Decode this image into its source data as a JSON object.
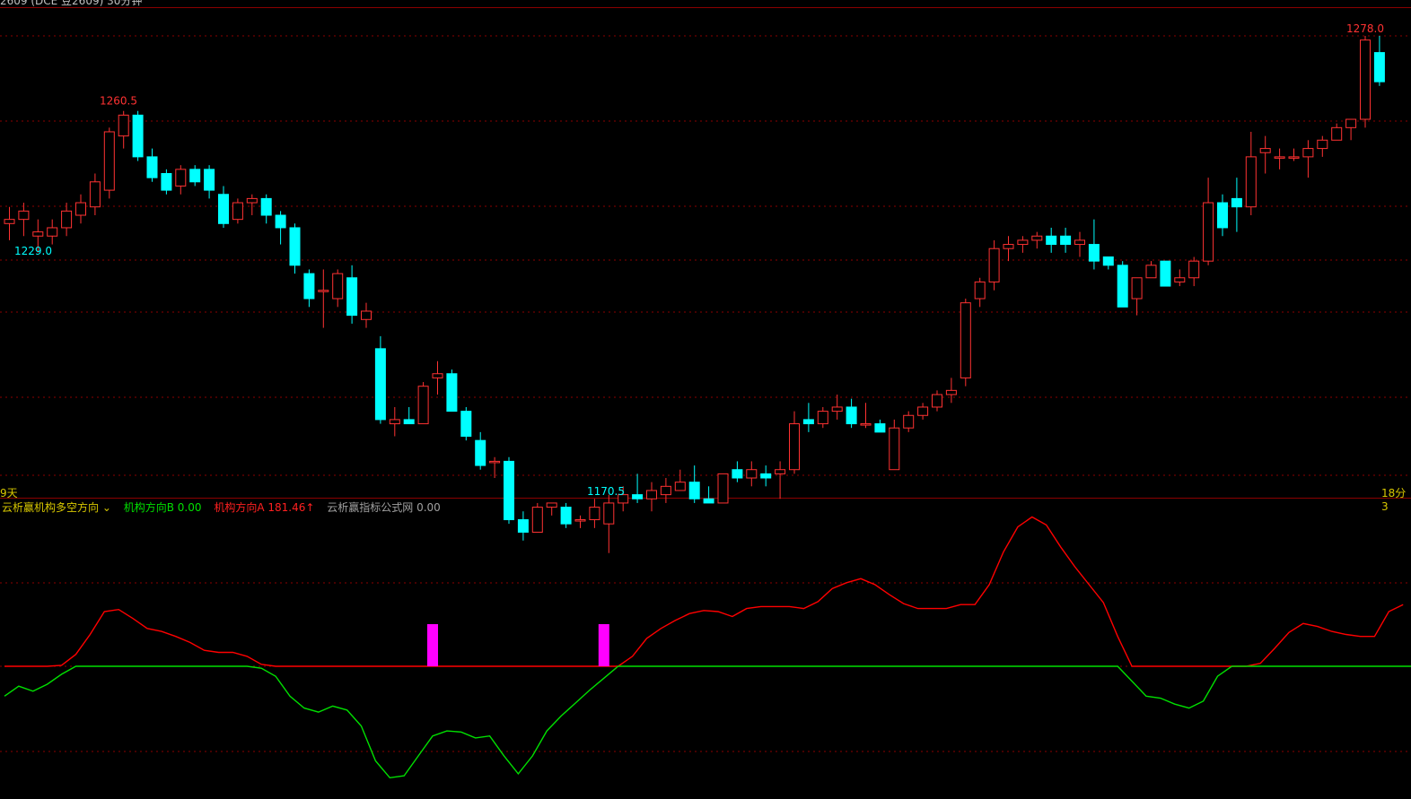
{
  "header": {
    "title_fragment": "2609 (DCE 豆2609) 30分钟"
  },
  "footer": {
    "left_text": "9天",
    "right_text": "18分3"
  },
  "indicator_legend": {
    "name": "云析赢机构多空方向",
    "b_label": "机构方向B",
    "b_value": "0.00",
    "a_label": "机构方向A",
    "a_value": "181.46↑",
    "c_label": "云析赢指标公式网",
    "c_value": "0.00"
  },
  "colors": {
    "up": "#ff3232",
    "down": "#00ffff",
    "lineA": "#ff0000",
    "lineB": "#00e000",
    "signal": "#ff00ff",
    "grid": "#8b0000"
  },
  "chart_data": [
    {
      "type": "candlestick",
      "annotations": {
        "high": "1278.0",
        "high2": "1260.5",
        "low": "1170.5",
        "low2": "1229.0"
      },
      "ohlc": [
        [
          1233,
          1237,
          1229,
          1234
        ],
        [
          1234,
          1238,
          1230,
          1236
        ],
        [
          1230,
          1234,
          1226,
          1231
        ],
        [
          1230,
          1234,
          1228,
          1232
        ],
        [
          1232,
          1238,
          1230,
          1236
        ],
        [
          1235,
          1240,
          1233,
          1238
        ],
        [
          1237,
          1245,
          1235,
          1243
        ],
        [
          1241,
          1256,
          1239,
          1255
        ],
        [
          1254,
          1260,
          1251,
          1259
        ],
        [
          1259,
          1260,
          1248,
          1249
        ],
        [
          1249,
          1251,
          1243,
          1244
        ],
        [
          1245,
          1246,
          1240,
          1241
        ],
        [
          1242,
          1247,
          1240,
          1246
        ],
        [
          1246,
          1247,
          1242,
          1243
        ],
        [
          1246,
          1247,
          1239,
          1241
        ],
        [
          1240,
          1242,
          1232,
          1233
        ],
        [
          1234,
          1239,
          1233,
          1238
        ],
        [
          1238,
          1240,
          1235,
          1239
        ],
        [
          1239,
          1240,
          1233,
          1235
        ],
        [
          1235,
          1236,
          1228,
          1232
        ],
        [
          1232,
          1233,
          1221,
          1223
        ],
        [
          1221,
          1222,
          1213,
          1215
        ],
        [
          1217,
          1222,
          1208,
          1217
        ],
        [
          1215,
          1222,
          1213,
          1221
        ],
        [
          1220,
          1223,
          1209,
          1211
        ],
        [
          1210,
          1214,
          1208,
          1212
        ],
        [
          1203,
          1206,
          1185,
          1186
        ],
        [
          1185,
          1189,
          1182,
          1186
        ],
        [
          1186,
          1189,
          1185,
          1185
        ],
        [
          1185,
          1195,
          1185,
          1194
        ],
        [
          1196,
          1200,
          1192,
          1197
        ],
        [
          1197,
          1198,
          1188,
          1188
        ],
        [
          1188,
          1189,
          1181,
          1182
        ],
        [
          1181,
          1183,
          1174,
          1175
        ],
        [
          1176,
          1177,
          1172,
          1176
        ],
        [
          1176,
          1177,
          1161,
          1162
        ],
        [
          1162,
          1164,
          1157,
          1159
        ],
        [
          1159,
          1166,
          1159,
          1165
        ],
        [
          1165,
          1166,
          1163,
          1166
        ],
        [
          1165,
          1166,
          1160,
          1161
        ],
        [
          1162,
          1163,
          1160,
          1162
        ],
        [
          1162,
          1167,
          1160,
          1165
        ],
        [
          1161,
          1168,
          1154,
          1166
        ],
        [
          1166,
          1170,
          1164,
          1168
        ],
        [
          1168,
          1173,
          1166,
          1167
        ],
        [
          1167,
          1171,
          1164,
          1169
        ],
        [
          1168,
          1172,
          1166,
          1170
        ],
        [
          1169,
          1174,
          1169,
          1171
        ],
        [
          1171,
          1175,
          1166,
          1167
        ],
        [
          1167,
          1170,
          1166,
          1166
        ],
        [
          1166,
          1173,
          1166,
          1173
        ],
        [
          1174,
          1176,
          1171,
          1172
        ],
        [
          1172,
          1176,
          1170,
          1174
        ],
        [
          1173,
          1175,
          1170,
          1172
        ],
        [
          1173,
          1176,
          1167,
          1174
        ],
        [
          1174,
          1188,
          1173,
          1185
        ],
        [
          1186,
          1190,
          1183,
          1185
        ],
        [
          1185,
          1189,
          1184,
          1188
        ],
        [
          1188,
          1192,
          1186,
          1189
        ],
        [
          1189,
          1191,
          1184,
          1185
        ],
        [
          1185,
          1190,
          1184,
          1185
        ],
        [
          1185,
          1186,
          1183,
          1183
        ],
        [
          1174,
          1186,
          1174,
          1184
        ],
        [
          1184,
          1188,
          1183,
          1187
        ],
        [
          1187,
          1190,
          1186,
          1189
        ],
        [
          1189,
          1193,
          1188,
          1192
        ],
        [
          1192,
          1196,
          1190,
          1193
        ],
        [
          1196,
          1215,
          1194,
          1214
        ],
        [
          1215,
          1220,
          1213,
          1219
        ],
        [
          1219,
          1229,
          1217,
          1227
        ],
        [
          1227,
          1230,
          1224,
          1228
        ],
        [
          1228,
          1230,
          1226,
          1229
        ],
        [
          1229,
          1231,
          1227,
          1230
        ],
        [
          1230,
          1232,
          1226,
          1228
        ],
        [
          1230,
          1232,
          1226,
          1228
        ],
        [
          1228,
          1231,
          1225,
          1229
        ],
        [
          1228,
          1234,
          1222,
          1224
        ],
        [
          1225,
          1225,
          1222,
          1223
        ],
        [
          1223,
          1224,
          1213,
          1213
        ],
        [
          1215,
          1220,
          1211,
          1220
        ],
        [
          1220,
          1224,
          1220,
          1223
        ],
        [
          1224,
          1224,
          1218,
          1218
        ],
        [
          1219,
          1222,
          1218,
          1220
        ],
        [
          1220,
          1225,
          1218,
          1224
        ],
        [
          1224,
          1244,
          1223,
          1238
        ],
        [
          1238,
          1240,
          1230,
          1232
        ],
        [
          1239,
          1244,
          1231,
          1237
        ],
        [
          1237,
          1255,
          1235,
          1249
        ],
        [
          1250,
          1254,
          1245,
          1251
        ],
        [
          1249,
          1251,
          1246,
          1249
        ],
        [
          1249,
          1251,
          1248,
          1249
        ],
        [
          1249,
          1253,
          1244,
          1251
        ],
        [
          1251,
          1254,
          1249,
          1253
        ],
        [
          1253,
          1257,
          1253,
          1256
        ],
        [
          1256,
          1258,
          1253,
          1258
        ],
        [
          1258,
          1278,
          1256,
          1277
        ],
        [
          1274,
          1278,
          1266,
          1267
        ]
      ]
    },
    {
      "type": "line",
      "series": [
        {
          "name": "机构方向A",
          "values": [
            0,
            0,
            0,
            0,
            1,
            12,
            32,
            55,
            57,
            48,
            38,
            35,
            30,
            24,
            16,
            14,
            14,
            10,
            2,
            0,
            0,
            0,
            0,
            0,
            0,
            0,
            0,
            0,
            0,
            0,
            0,
            0,
            0,
            0,
            0,
            0,
            0,
            0,
            0,
            0,
            0,
            0,
            0,
            0,
            10,
            28,
            38,
            46,
            53,
            56,
            55,
            50,
            58,
            60,
            60,
            60,
            58,
            65,
            78,
            84,
            88,
            82,
            72,
            63,
            58,
            58,
            58,
            62,
            62,
            82,
            115,
            140,
            150,
            142,
            120,
            100,
            82,
            64,
            30,
            0,
            0,
            0,
            0,
            0,
            0,
            0,
            0,
            0,
            3,
            18,
            34,
            43,
            40,
            35,
            32,
            30,
            30,
            55,
            62
          ]
        },
        {
          "name": "机构方向B",
          "values": [
            -30,
            -20,
            -25,
            -18,
            -8,
            0,
            0,
            0,
            0,
            0,
            0,
            0,
            0,
            0,
            0,
            0,
            0,
            0,
            -2,
            -10,
            -30,
            -42,
            -46,
            -40,
            -44,
            -60,
            -95,
            -112,
            -110,
            -90,
            -70,
            -65,
            -66,
            -72,
            -70,
            -90,
            -108,
            -90,
            -65,
            -50,
            -37,
            -24,
            -12,
            0,
            0,
            0,
            0,
            0,
            0,
            0,
            0,
            0,
            0,
            0,
            0,
            0,
            0,
            0,
            0,
            0,
            0,
            0,
            0,
            0,
            0,
            0,
            0,
            0,
            0,
            0,
            0,
            0,
            0,
            0,
            0,
            0,
            0,
            0,
            0,
            -15,
            -30,
            -32,
            -38,
            -42,
            -35,
            -10,
            0,
            0,
            0,
            0,
            0,
            0,
            0,
            0,
            0,
            0,
            0,
            0,
            0,
            0
          ]
        }
      ],
      "signals": [
        30,
        42
      ]
    }
  ]
}
